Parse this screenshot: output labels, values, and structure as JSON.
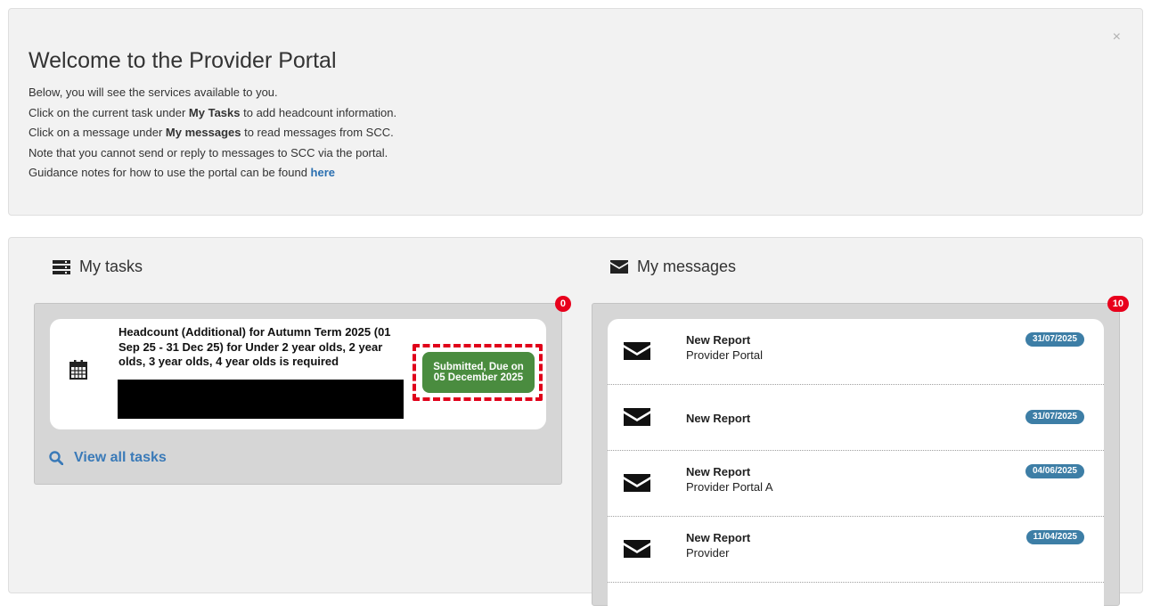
{
  "welcome": {
    "title": "Welcome to the Provider Portal",
    "close_label": "×",
    "line1": "Below, you will see the services available to you.",
    "line2_pre": "Click on the current task under ",
    "line2_bold": "My Tasks",
    "line2_post": " to add headcount information.",
    "line3_pre": "Click on a message under ",
    "line3_bold": "My messages",
    "line3_post": " to read messages from SCC.",
    "line4": "Note that you cannot send or reply to messages to SCC via the portal.",
    "line5_pre": "Guidance notes for how to use the portal can be found ",
    "line5_link": "here"
  },
  "tasks": {
    "heading": "My tasks",
    "count": "0",
    "icon": "server-icon",
    "items": [
      {
        "title": "Headcount (Additional) for Autumn Term 2025 (01 Sep 25 - 31 Dec 25) for Under 2 year olds, 2 year olds, 3 year olds, 4 year olds is required",
        "status": "Submitted, Due on 05 December 2025",
        "icon": "calendar-icon"
      }
    ],
    "view_all": "View all tasks"
  },
  "messages": {
    "heading": "My messages",
    "count": "10",
    "icon": "envelope-icon",
    "items": [
      {
        "subject": "New Report",
        "from": "Provider Portal",
        "date": "31/07/2025"
      },
      {
        "subject": "New Report",
        "from": "",
        "date": "31/07/2025"
      },
      {
        "subject": "New Report",
        "from": "Provider Portal A",
        "date": "04/06/2025"
      },
      {
        "subject": "New Report",
        "from": "Provider",
        "date": "11/04/2025"
      }
    ]
  },
  "colors": {
    "panel_bg": "#f2f2f2",
    "well_bg": "#d6d6d6",
    "count_badge": "#e8001c",
    "status_green": "#4a8c3f",
    "date_badge": "#3d7ea6",
    "link_blue": "#2a6fb0",
    "highlight_red": "#e0001a"
  }
}
